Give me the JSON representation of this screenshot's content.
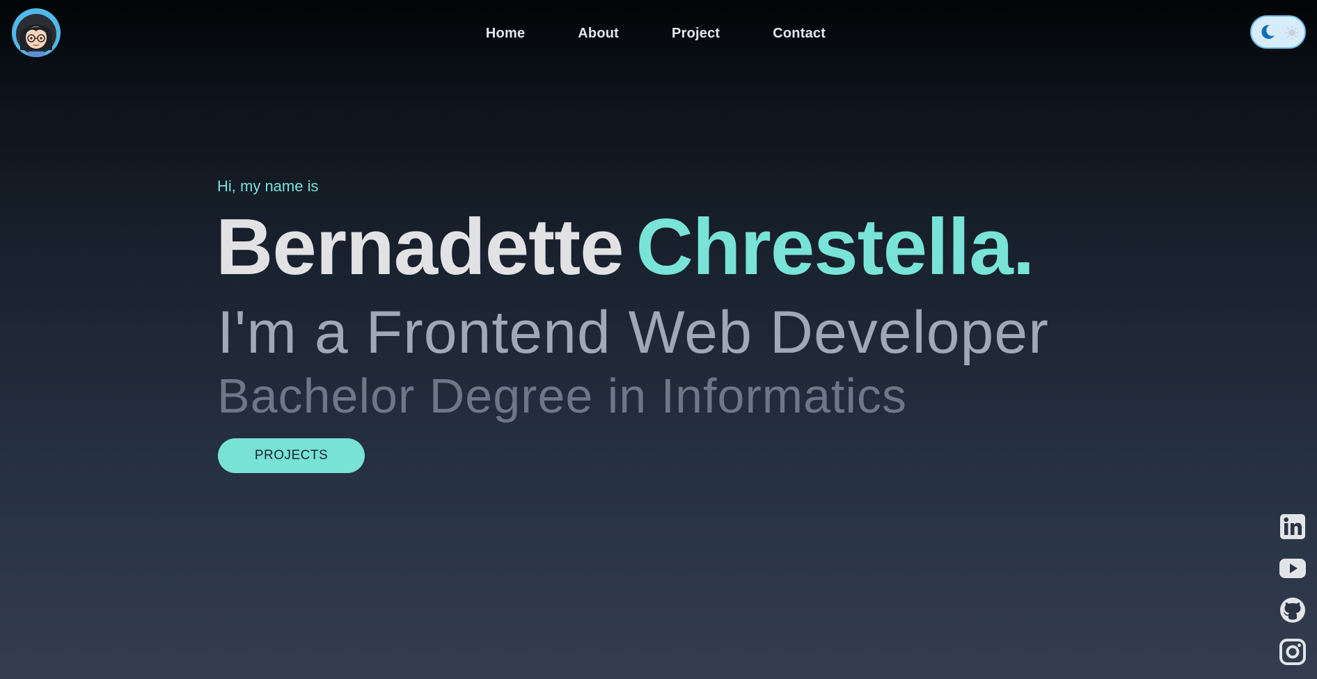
{
  "header": {
    "nav": [
      {
        "label": "Home"
      },
      {
        "label": "About"
      },
      {
        "label": "Project"
      },
      {
        "label": "Contact"
      }
    ],
    "avatar_icon": "avatar-cartoon-girl-glasses",
    "theme_toggle": {
      "moon_icon": "moon-icon",
      "sun_icon": "sun-icon",
      "mode": "dark"
    }
  },
  "hero": {
    "greeting": "Hi, my name is",
    "first_name": "Bernadette",
    "last_name": "Chrestella.",
    "role": "I'm a Frontend Web Developer",
    "degree": "Bachelor Degree in Informatics",
    "button_label": "PROJECTS"
  },
  "social": [
    "linkedin-icon",
    "youtube-icon",
    "github-icon",
    "instagram-icon"
  ],
  "colors": {
    "accent": "#78e2d6",
    "background_top": "#020305",
    "background_bottom": "#333d4f",
    "text_light": "#e2e2e4",
    "role_text": "#a0a8b6",
    "degree_text": "#6e7787",
    "avatar_ring": "#4fb9ea"
  }
}
